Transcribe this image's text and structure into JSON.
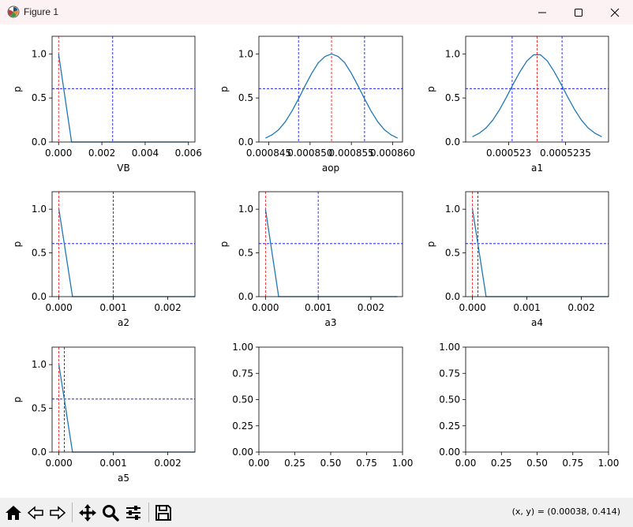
{
  "window": {
    "title": "Figure 1",
    "minimize_icon": "minimize-icon",
    "maximize_icon": "maximize-icon",
    "close_icon": "close-icon"
  },
  "toolbar": {
    "tools": [
      {
        "name": "home-button",
        "icon": "home-icon"
      },
      {
        "name": "back-button",
        "icon": "back-arrow-icon"
      },
      {
        "name": "forward-button",
        "icon": "forward-arrow-icon"
      },
      {
        "name": "pan-button",
        "icon": "move-icon"
      },
      {
        "name": "zoom-button",
        "icon": "magnifier-icon"
      },
      {
        "name": "configure-subplots-button",
        "icon": "sliders-icon"
      },
      {
        "name": "save-button",
        "icon": "save-icon"
      }
    ],
    "coords": "(x, y) = (0.00038, 0.414)"
  },
  "colors": {
    "line": "#1f77b4",
    "red_ref": "#ff0000",
    "blue_ref": "#0000ff"
  },
  "chart_data": [
    {
      "type": "line",
      "xlabel": "VB",
      "ylabel": "p",
      "xlim": [
        -0.0003,
        0.0063
      ],
      "ylim": [
        0,
        1.2
      ],
      "xticks": [
        0.0,
        0.002,
        0.004,
        0.006
      ],
      "xtick_labels": [
        "0.000",
        "0.002",
        "0.004",
        "0.006"
      ],
      "yticks": [
        0.0,
        0.5,
        1.0
      ],
      "ytick_labels": [
        "0.0",
        "0.5",
        "1.0"
      ],
      "x": [
        0.0,
        0.0006,
        0.006
      ],
      "y": [
        1.0,
        0.0,
        0.0
      ],
      "vline_red": 0.0,
      "vline_blue": 0.0025,
      "hline_blue": 0.606
    },
    {
      "type": "line",
      "xlabel": "aop",
      "ylabel": "p",
      "xlim": [
        0.0008438,
        0.0008612
      ],
      "ylim": [
        0,
        1.2
      ],
      "xticks": [
        0.000845,
        0.00085,
        0.000855,
        0.00086
      ],
      "xtick_labels": [
        "0.000845",
        "0.000850",
        "0.000855",
        "0.000860"
      ],
      "yticks": [
        0.0,
        0.5,
        1.0
      ],
      "ytick_labels": [
        "0.0",
        "0.5",
        "1.0"
      ],
      "x": [
        0.0008446,
        0.0008454,
        0.0008462,
        0.000847,
        0.0008478,
        0.0008486,
        0.0008494,
        0.0008502,
        0.000851,
        0.0008518,
        0.0008526,
        0.0008534,
        0.0008542,
        0.000855,
        0.0008558,
        0.0008566,
        0.0008574,
        0.0008582,
        0.000859,
        0.0008598,
        0.0008606
      ],
      "y": [
        0.044,
        0.082,
        0.14,
        0.23,
        0.35,
        0.49,
        0.64,
        0.78,
        0.9,
        0.97,
        1.0,
        0.97,
        0.9,
        0.78,
        0.64,
        0.49,
        0.35,
        0.23,
        0.14,
        0.082,
        0.044
      ],
      "vline_red": 0.0008526,
      "vline_blue": [
        0.0008486,
        0.0008566
      ],
      "hline_blue": 0.606
    },
    {
      "type": "line",
      "xlabel": "a1",
      "ylabel": "p",
      "xlim": [
        0.00052262,
        0.00052388
      ],
      "ylim": [
        0,
        1.2
      ],
      "xticks": [
        0.000523,
        0.0005235
      ],
      "xtick_labels": [
        "0.000523",
        "0.0005235"
      ],
      "yticks": [
        0.0,
        0.5,
        1.0
      ],
      "ytick_labels": [
        "0.0",
        "0.5",
        "1.0"
      ],
      "x": [
        0.00052268,
        0.00052274,
        0.0005228,
        0.00052286,
        0.00052292,
        0.00052298,
        0.00052304,
        0.0005231,
        0.00052316,
        0.00052322,
        0.00052328,
        0.00052334,
        0.0005234,
        0.00052346,
        0.00052352,
        0.00052358,
        0.00052364,
        0.0005237,
        0.00052376,
        0.00052382
      ],
      "y": [
        0.06,
        0.1,
        0.16,
        0.25,
        0.37,
        0.51,
        0.66,
        0.8,
        0.92,
        0.99,
        0.99,
        0.92,
        0.8,
        0.66,
        0.51,
        0.37,
        0.25,
        0.16,
        0.1,
        0.06
      ],
      "vline_red": 0.00052325,
      "vline_blue": [
        0.00052303,
        0.00052347
      ],
      "hline_blue": 0.606
    },
    {
      "type": "line",
      "xlabel": "a2",
      "ylabel": "p",
      "xlim": [
        -0.000125,
        0.0025
      ],
      "ylim": [
        0,
        1.2
      ],
      "xticks": [
        0.0,
        0.001,
        0.002
      ],
      "xtick_labels": [
        "0.000",
        "0.001",
        "0.002"
      ],
      "yticks": [
        0.0,
        0.5,
        1.0
      ],
      "ytick_labels": [
        "0.0",
        "0.5",
        "1.0"
      ],
      "x": [
        0.0,
        0.00025,
        0.0025
      ],
      "y": [
        1.0,
        0.0,
        0.0
      ],
      "vline_red": 0.0,
      "vline_blue": 0.001,
      "hline_blue": 0.606
    },
    {
      "type": "line",
      "xlabel": "a3",
      "ylabel": "p",
      "xlim": [
        -0.000125,
        0.0026
      ],
      "ylim": [
        0,
        1.2
      ],
      "xticks": [
        0.0,
        0.001,
        0.002
      ],
      "xtick_labels": [
        "0.000",
        "0.001",
        "0.002"
      ],
      "yticks": [
        0.0,
        0.5,
        1.0
      ],
      "ytick_labels": [
        "0.0",
        "0.5",
        "1.0"
      ],
      "x": [
        0.0,
        0.00025,
        0.0025
      ],
      "y": [
        1.0,
        0.0,
        0.0
      ],
      "vline_red": 0.0,
      "vline_blue": 0.001,
      "hline_blue": 0.606
    },
    {
      "type": "line",
      "xlabel": "a4",
      "ylabel": "p",
      "xlim": [
        -0.000125,
        0.0025
      ],
      "ylim": [
        0,
        1.2
      ],
      "xticks": [
        0.0,
        0.001,
        0.002
      ],
      "xtick_labels": [
        "0.000",
        "0.001",
        "0.002"
      ],
      "yticks": [
        0.0,
        0.5,
        1.0
      ],
      "ytick_labels": [
        "0.0",
        "0.5",
        "1.0"
      ],
      "x": [
        0.0,
        0.00025,
        0.0025
      ],
      "y": [
        1.0,
        0.0,
        0.0
      ],
      "vline_red": 0.0,
      "vline_blue": 0.0001,
      "hline_blue": 0.606
    },
    {
      "type": "line",
      "xlabel": "a5",
      "ylabel": "p",
      "xlim": [
        -0.000125,
        0.0025
      ],
      "ylim": [
        0,
        1.2
      ],
      "xticks": [
        0.0,
        0.001,
        0.002
      ],
      "xtick_labels": [
        "0.000",
        "0.001",
        "0.002"
      ],
      "yticks": [
        0.0,
        0.5,
        1.0
      ],
      "ytick_labels": [
        "0.0",
        "0.5",
        "1.0"
      ],
      "x": [
        0.0,
        0.00025,
        0.0025
      ],
      "y": [
        1.0,
        0.0,
        0.0
      ],
      "vline_red": 0.0,
      "vline_blue": 0.0001,
      "hline_blue": 0.606
    },
    {
      "type": "line",
      "xlabel": "",
      "ylabel": "",
      "xlim": [
        0,
        1
      ],
      "ylim": [
        0,
        1
      ],
      "xticks": [
        0.0,
        0.25,
        0.5,
        0.75,
        1.0
      ],
      "xtick_labels": [
        "0.00",
        "0.25",
        "0.50",
        "0.75",
        "1.00"
      ],
      "yticks": [
        0.0,
        0.25,
        0.5,
        0.75,
        1.0
      ],
      "ytick_labels": [
        "0.00",
        "0.25",
        "0.50",
        "0.75",
        "1.00"
      ],
      "x": [],
      "y": []
    },
    {
      "type": "line",
      "xlabel": "",
      "ylabel": "",
      "xlim": [
        0,
        1
      ],
      "ylim": [
        0,
        1
      ],
      "xticks": [
        0.0,
        0.25,
        0.5,
        0.75,
        1.0
      ],
      "xtick_labels": [
        "0.00",
        "0.25",
        "0.50",
        "0.75",
        "1.00"
      ],
      "yticks": [
        0.0,
        0.25,
        0.5,
        0.75,
        1.0
      ],
      "ytick_labels": [
        "0.00",
        "0.25",
        "0.50",
        "0.75",
        "1.00"
      ],
      "x": [],
      "y": []
    }
  ]
}
